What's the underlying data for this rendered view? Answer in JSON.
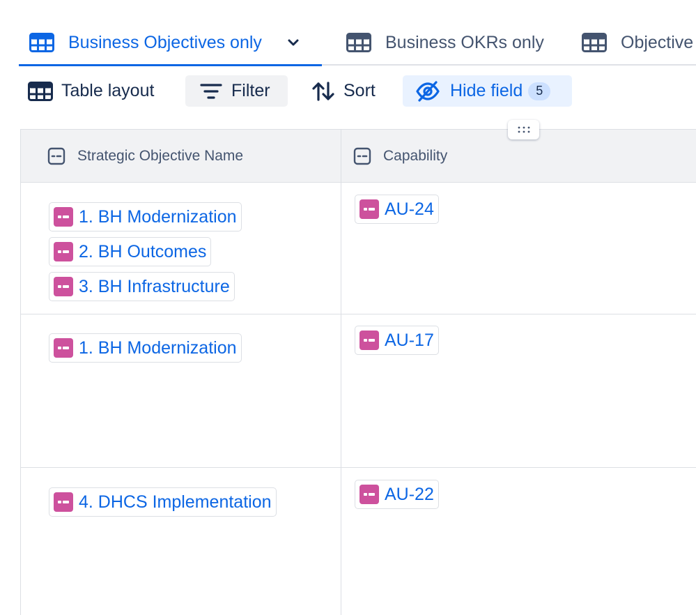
{
  "tabs": [
    {
      "label": "Business Objectives only",
      "active": true
    },
    {
      "label": "Business OKRs only",
      "active": false
    },
    {
      "label": "Objective",
      "active": false
    }
  ],
  "toolbar": {
    "layout_label": "Table layout",
    "filter_label": "Filter",
    "sort_label": "Sort",
    "hide_label": "Hide field",
    "hide_count": "5"
  },
  "table": {
    "columns": [
      "Strategic Objective Name",
      "Capability"
    ],
    "rows": [
      {
        "objectives": [
          "1. BH Modernization",
          "2. BH Outcomes",
          "3. BH Infrastructure"
        ],
        "capability": "AU-24"
      },
      {
        "objectives": [
          "1. BH Modernization"
        ],
        "capability": "AU-17"
      },
      {
        "objectives": [
          "4. DHCS Implementation"
        ],
        "capability": "AU-22"
      }
    ]
  },
  "colors": {
    "accent": "#0c66e4",
    "chip_icon": "#cd519d",
    "hide_bg": "#e9f2ff",
    "filter_bg": "#f1f2f4"
  },
  "icons": {
    "view": "table-grid-icon",
    "filter": "filter-icon",
    "sort": "sort-arrows-icon",
    "hide": "eye-off-icon",
    "field": "field-icon",
    "item": "work-item-icon"
  }
}
